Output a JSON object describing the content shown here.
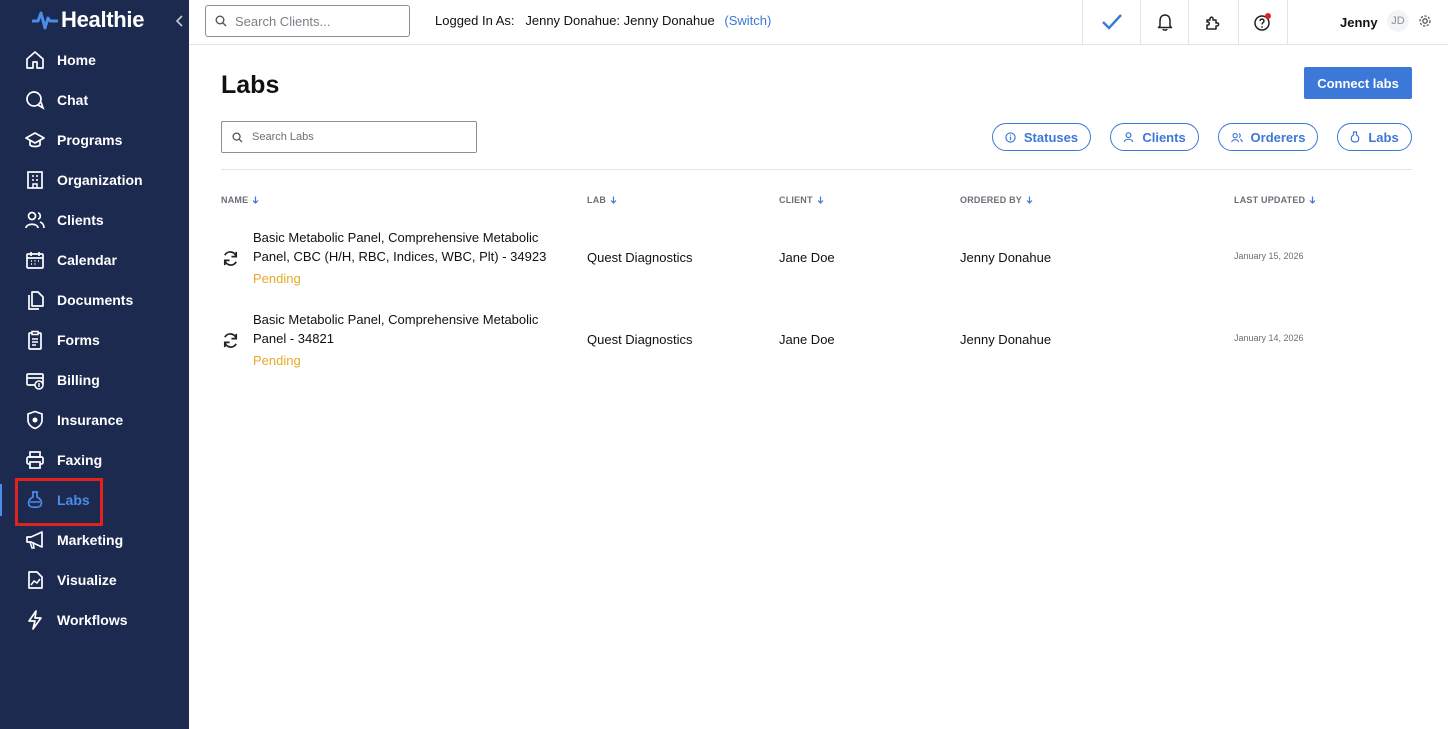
{
  "brand": {
    "name": "Healthie",
    "accent": "#3c78d8",
    "sidebar_bg": "#1b2a4e",
    "highlight": "#e0241b"
  },
  "sidebar": {
    "items": [
      {
        "label": "Home",
        "icon": "home-icon"
      },
      {
        "label": "Chat",
        "icon": "chat-icon"
      },
      {
        "label": "Programs",
        "icon": "graduation-cap-icon"
      },
      {
        "label": "Organization",
        "icon": "building-icon"
      },
      {
        "label": "Clients",
        "icon": "users-icon"
      },
      {
        "label": "Calendar",
        "icon": "calendar-icon"
      },
      {
        "label": "Documents",
        "icon": "documents-icon"
      },
      {
        "label": "Forms",
        "icon": "clipboard-icon"
      },
      {
        "label": "Billing",
        "icon": "billing-icon"
      },
      {
        "label": "Insurance",
        "icon": "shield-icon"
      },
      {
        "label": "Faxing",
        "icon": "printer-icon"
      },
      {
        "label": "Labs",
        "icon": "flask-icon",
        "active": true
      },
      {
        "label": "Marketing",
        "icon": "megaphone-icon"
      },
      {
        "label": "Visualize",
        "icon": "chart-doc-icon"
      },
      {
        "label": "Workflows",
        "icon": "lightning-icon"
      }
    ]
  },
  "topbar": {
    "search_placeholder": "Search Clients...",
    "logged_in_prefix": "Logged In As:",
    "logged_in_user": "Jenny Donahue: Jenny Donahue",
    "switch_label": "(Switch)",
    "user_name": "Jenny",
    "avatar_initials": "JD"
  },
  "main": {
    "title": "Labs",
    "connect_button": "Connect labs",
    "search_placeholder": "Search Labs",
    "filters": {
      "statuses": "Statuses",
      "clients": "Clients",
      "orderers": "Orderers",
      "labs": "Labs"
    },
    "columns": {
      "name": "NAME",
      "lab": "LAB",
      "client": "CLIENT",
      "ordered_by": "ORDERED BY",
      "last_updated": "LAST UPDATED"
    },
    "rows": [
      {
        "name": "Basic Metabolic Panel, Comprehensive Metabolic Panel, CBC (H/H, RBC, Indices, WBC, Plt) - 34923",
        "status": "Pending",
        "lab": "Quest Diagnostics",
        "client": "Jane Doe",
        "ordered_by": "Jenny Donahue",
        "last_updated": "January 15, 2026"
      },
      {
        "name": "Basic Metabolic Panel, Comprehensive Metabolic Panel - 34821",
        "status": "Pending",
        "lab": "Quest Diagnostics",
        "client": "Jane Doe",
        "ordered_by": "Jenny Donahue",
        "last_updated": "January 14, 2026"
      }
    ]
  }
}
